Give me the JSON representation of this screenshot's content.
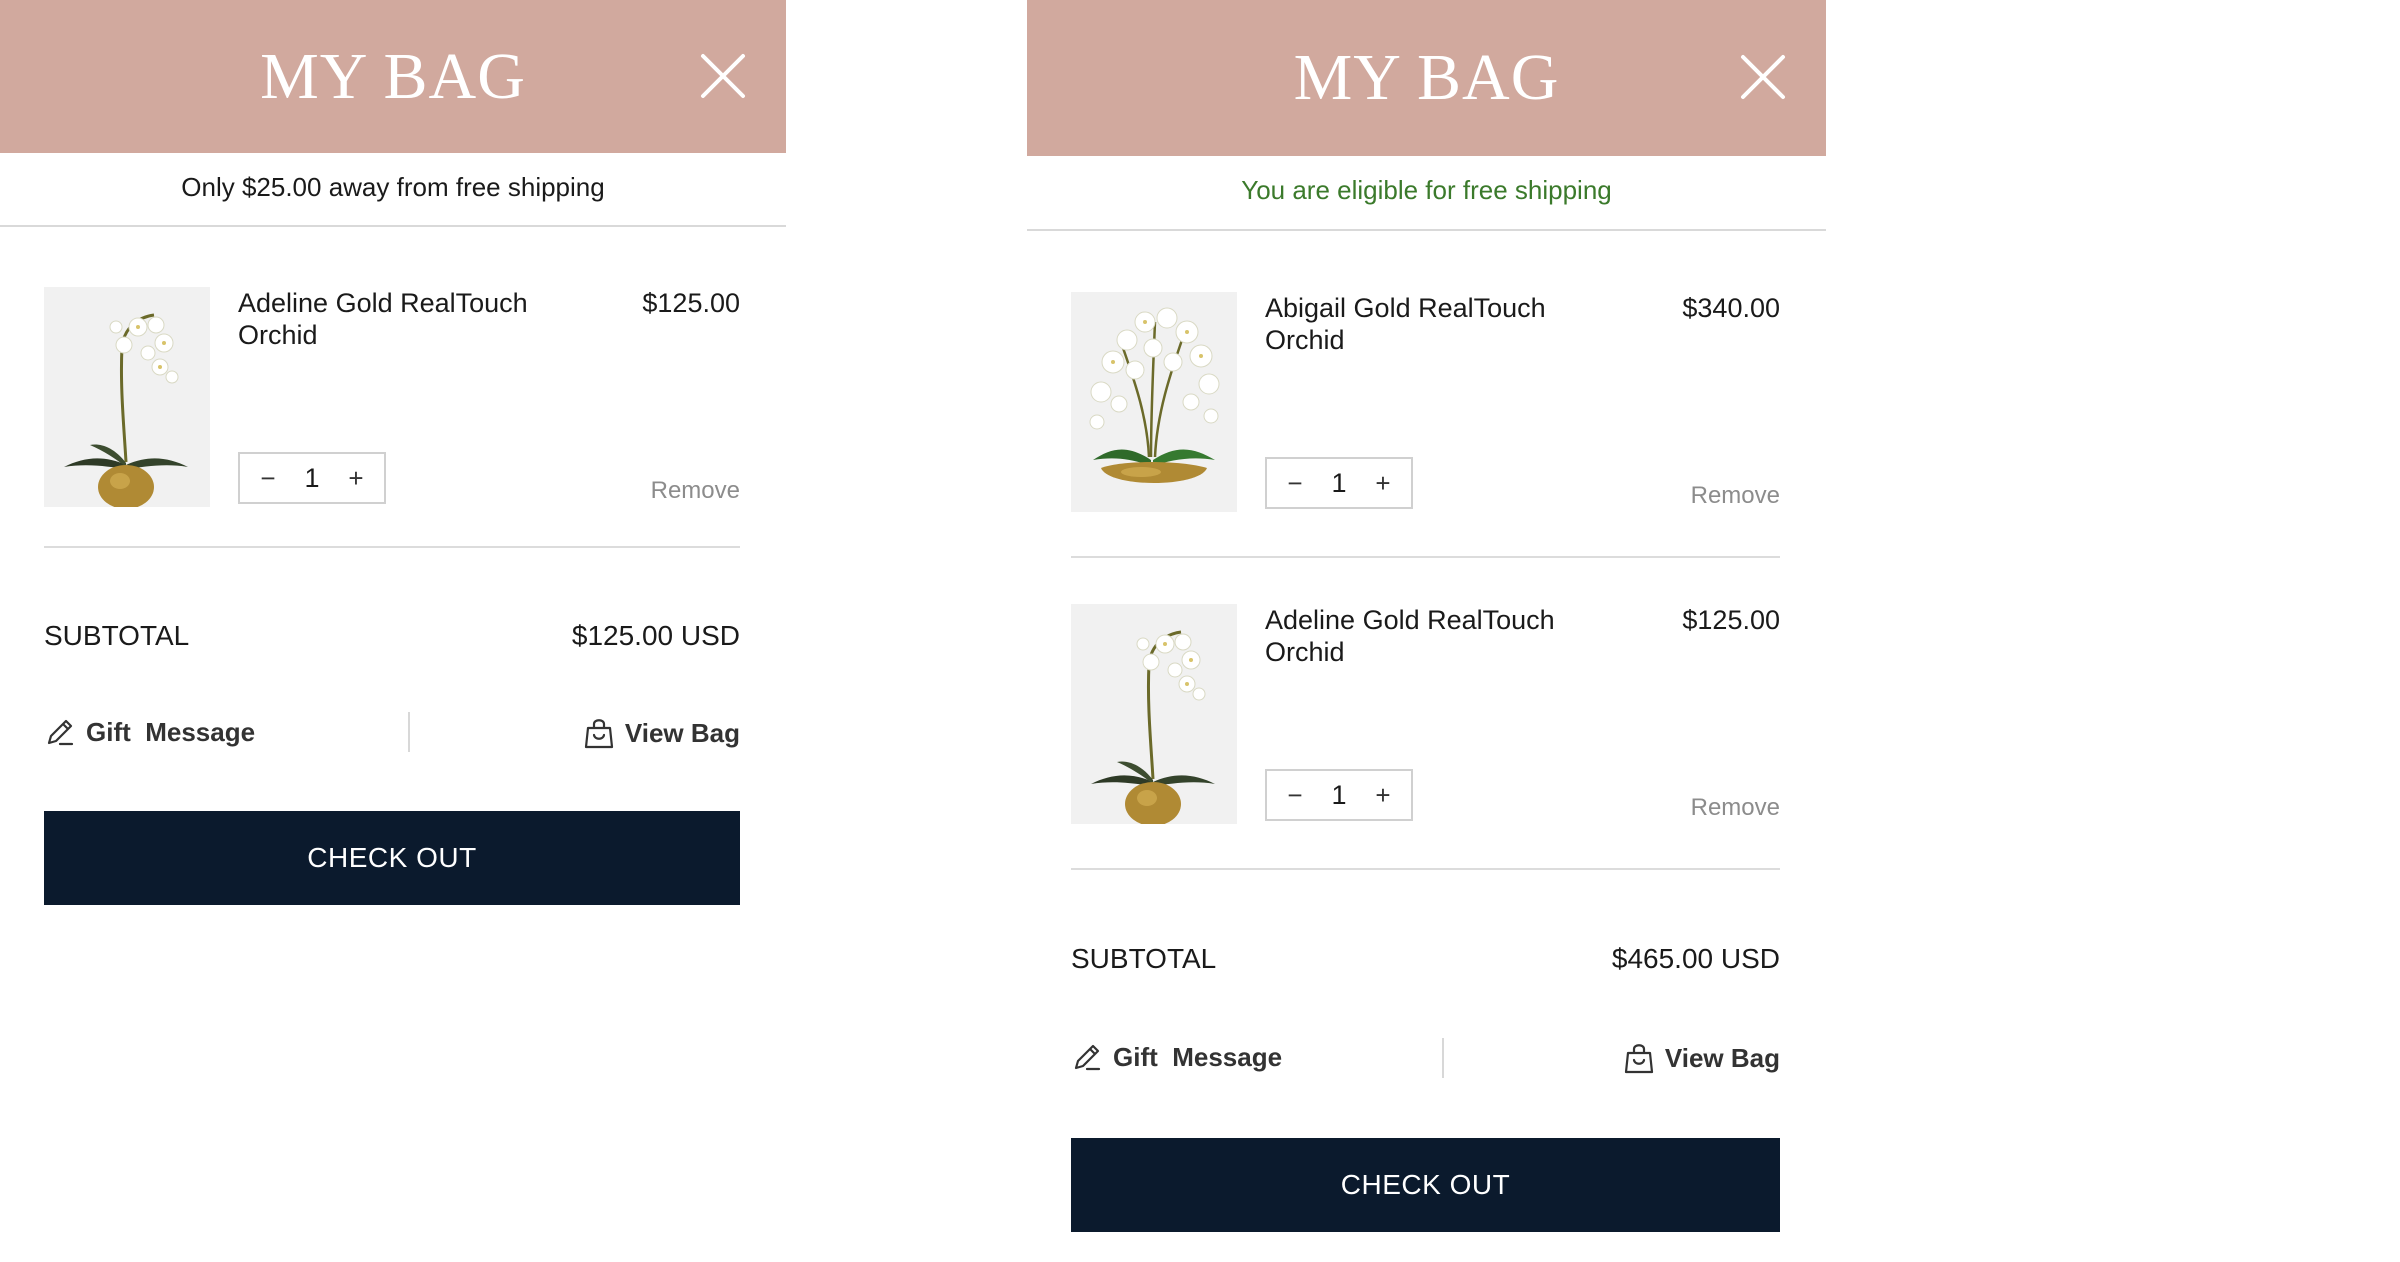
{
  "panels": [
    {
      "title": "MY BAG",
      "shipping_message": "Only $25.00 away from free shipping",
      "items": [
        {
          "name": "Adeline Gold RealTouch Orchid",
          "price": "$125.00",
          "quantity": "1",
          "remove_label": "Remove",
          "image_icon": "orchid-single-stem-gold-vase"
        }
      ],
      "subtotal_label": "SUBTOTAL",
      "subtotal_value": "$125.00 USD",
      "gift_message_label": "Gift  Message",
      "view_bag_label": "View Bag",
      "checkout_label": "CHECK OUT"
    },
    {
      "title": "MY BAG",
      "shipping_message": "You are eligible for free shipping",
      "items": [
        {
          "name": "Abigail Gold RealTouch Orchid",
          "price": "$340.00",
          "quantity": "1",
          "remove_label": "Remove",
          "image_icon": "orchid-multi-stem-gold-bowl"
        },
        {
          "name": "Adeline Gold RealTouch Orchid",
          "price": "$125.00",
          "quantity": "1",
          "remove_label": "Remove",
          "image_icon": "orchid-single-stem-gold-vase"
        }
      ],
      "subtotal_label": "SUBTOTAL",
      "subtotal_value": "$465.00 USD",
      "gift_message_label": "Gift  Message",
      "view_bag_label": "View Bag",
      "checkout_label": "CHECK OUT"
    }
  ],
  "icons": {
    "close": "close-icon",
    "gift": "pencil-icon",
    "view_bag": "shopping-bag-icon",
    "qty_minus": "−",
    "qty_plus": "+"
  },
  "colors": {
    "header_bg": "#d1a99e",
    "checkout_bg": "#0b1a2d",
    "free_shipping_text": "#3b7a2b",
    "muted_text": "#8c8c8c"
  }
}
